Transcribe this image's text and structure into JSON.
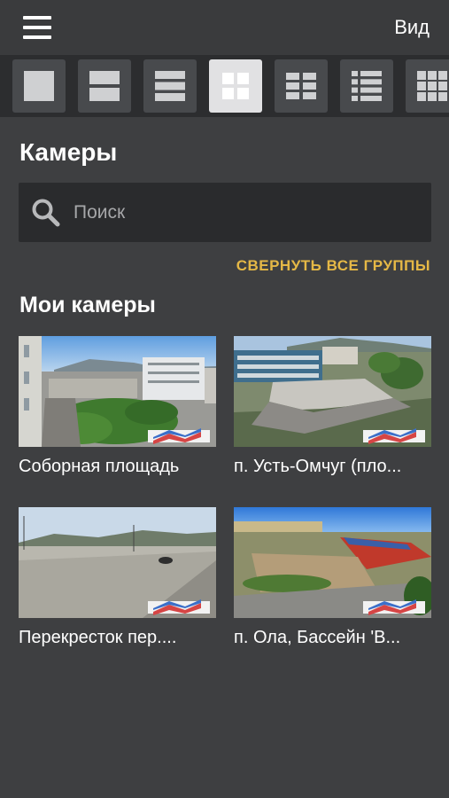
{
  "header": {
    "menu_icon": "hamburger-menu-icon",
    "view_label": "Вид"
  },
  "layouts": [
    {
      "name": "layout-1x1",
      "active": false
    },
    {
      "name": "layout-1x2",
      "active": false
    },
    {
      "name": "layout-1x3",
      "active": false
    },
    {
      "name": "layout-2x2",
      "active": true
    },
    {
      "name": "layout-2x3",
      "active": false
    },
    {
      "name": "layout-2x4",
      "active": false
    },
    {
      "name": "layout-3x3",
      "active": false
    }
  ],
  "main": {
    "title": "Камеры",
    "search": {
      "placeholder": "Поиск",
      "value": "",
      "icon": "search-icon"
    },
    "collapse_all_label": "СВЕРНУТЬ ВСЕ ГРУППЫ",
    "group": {
      "title": "Мои камеры",
      "cameras": [
        {
          "label": "Соборная площадь"
        },
        {
          "label": "п. Усть-Омчуг (пло..."
        },
        {
          "label": "Перекресток пер...."
        },
        {
          "label": "п. Ола, Бассейн 'В..."
        }
      ]
    }
  },
  "colors": {
    "background": "#3e3f41",
    "strip": "#2c2d2f",
    "accent": "#e5b846",
    "active_layout": "#e1e1e3"
  }
}
